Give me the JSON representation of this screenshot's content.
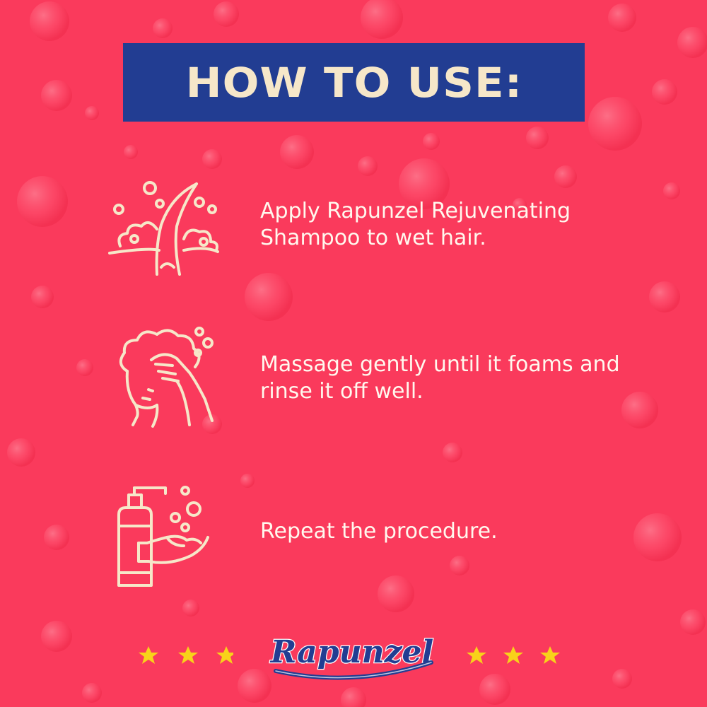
{
  "title": "HOW TO USE:",
  "steps": [
    {
      "icon": "hair-shampoo-icon",
      "text": "Apply Rapunzel Rejuvenating Shampoo to wet hair."
    },
    {
      "icon": "head-massage-icon",
      "text": "Massage gently until it foams and rinse it off well."
    },
    {
      "icon": "pump-bottle-hand-icon",
      "text": "Repeat the procedure."
    }
  ],
  "brand": {
    "name": "Rapunzel"
  },
  "colors": {
    "background": "#fa3a5c",
    "banner": "#223d92",
    "banner_text": "#f6e7c9",
    "body_text": "#fff8ee",
    "icon_stroke": "#f6e7c9",
    "stars": "#f8d21a"
  }
}
